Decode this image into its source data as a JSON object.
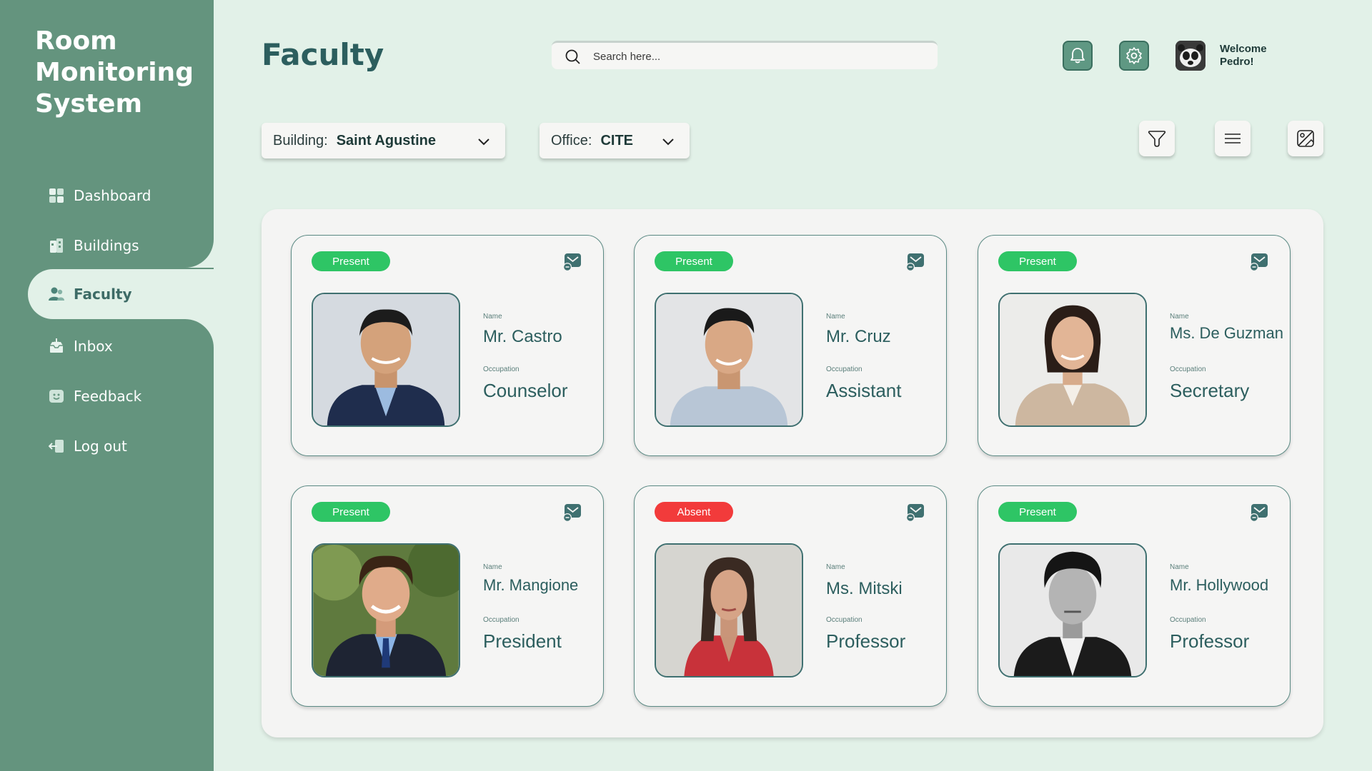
{
  "app": {
    "title": "Room Monitoring System"
  },
  "sidebar": {
    "items": [
      {
        "label": "Dashboard",
        "icon": "dashboard-icon"
      },
      {
        "label": "Buildings",
        "icon": "building-icon"
      },
      {
        "label": "Faculty",
        "icon": "users-icon",
        "active": true
      },
      {
        "label": "Inbox",
        "icon": "inbox-icon"
      },
      {
        "label": "Feedback",
        "icon": "feedback-icon"
      },
      {
        "label": "Log out",
        "icon": "logout-icon"
      }
    ]
  },
  "header": {
    "title": "Faculty",
    "search_placeholder": "Search here...",
    "welcome_line1": "Welcome",
    "welcome_line2": "Pedro!",
    "icons": [
      "bell-icon",
      "gear-icon",
      "user-avatar"
    ]
  },
  "filters": {
    "building_label": "Building:",
    "building_value": "Saint Agustine",
    "office_label": "Office:",
    "office_value": "CITE",
    "tools": [
      "filter-icon",
      "menu-icon",
      "image-icon"
    ]
  },
  "faculty_fields": {
    "name_label": "Name",
    "occupation_label": "Occupation"
  },
  "faculty": [
    {
      "status": "Present",
      "name": "Mr. Castro",
      "occupation": "Counselor"
    },
    {
      "status": "Present",
      "name": "Mr. Cruz",
      "occupation": "Assistant"
    },
    {
      "status": "Present",
      "name": "Ms. De Guzman",
      "occupation": "Secretary"
    },
    {
      "status": "Present",
      "name": "Mr. Mangione",
      "occupation": "President"
    },
    {
      "status": "Absent",
      "name": "Ms. Mitski",
      "occupation": "Professor"
    },
    {
      "status": "Present",
      "name": "Mr. Hollywood",
      "occupation": "Professor"
    }
  ],
  "colors": {
    "sidebar": "#64947e",
    "background": "#e2f1e8",
    "accent": "#2c5e5e",
    "present": "#2ec565",
    "absent": "#f23b3b"
  }
}
